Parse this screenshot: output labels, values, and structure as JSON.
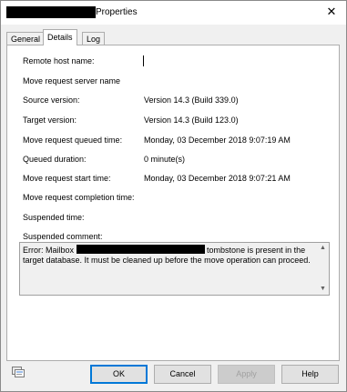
{
  "window": {
    "title": "Properties",
    "close_glyph": "✕"
  },
  "tabs": [
    {
      "label": "General",
      "active": false
    },
    {
      "label": "Details",
      "active": true
    },
    {
      "label": "Log",
      "active": false
    }
  ],
  "fields": [
    {
      "label": "Remote host name:",
      "value": ""
    },
    {
      "label": "Move request server name",
      "value": ""
    },
    {
      "label": "Source version:",
      "value": "Version 14.3 (Build 339.0)"
    },
    {
      "label": "Target version:",
      "value": "Version 14.3 (Build 123.0)"
    },
    {
      "label": "Move request queued time:",
      "value": "Monday, 03 December 2018 9:07:19 AM"
    },
    {
      "label": "Queued duration:",
      "value": "0 minute(s)"
    },
    {
      "label": "Move request start time:",
      "value": "Monday, 03 December 2018 9:07:21 AM"
    },
    {
      "label": "Move request completion time:",
      "value": ""
    },
    {
      "label": "Suspended time:",
      "value": ""
    },
    {
      "label": "Suspended comment:",
      "value": ""
    }
  ],
  "comment": {
    "prefix": "Error: Mailbox",
    "suffix": "tombstone is present in the target database. It must be cleaned up before the move operation can proceed."
  },
  "buttons": {
    "ok": "OK",
    "cancel": "Cancel",
    "apply": "Apply",
    "help": "Help"
  },
  "icons": {
    "footer": "properties-page-icon",
    "scroll_up": "▲",
    "scroll_down": "▼"
  },
  "colors": {
    "default_button_border": "#0078d7",
    "panel_bg": "#ffffff",
    "dialog_bg": "#f0f0f0"
  }
}
